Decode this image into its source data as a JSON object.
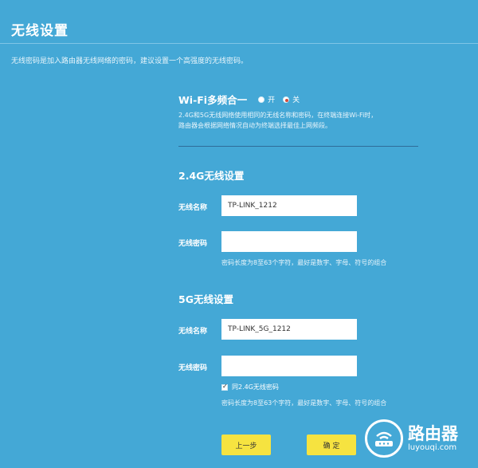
{
  "header": {
    "title": "无线设置",
    "intro": "无线密码是加入路由器无线网络的密码，建议设置一个高强度的无线密码。"
  },
  "wifi_multi": {
    "label": "Wi-Fi多频合一",
    "option_on": "开",
    "option_off": "关",
    "selected": "关",
    "description_line1": "2.4G和5G无线网络使用相同的无线名称和密码，在终端连接Wi-Fi时，",
    "description_line2": "路由器会根据网络情况自动为终端选择最佳上网频段。"
  },
  "band_24g": {
    "title": "2.4G无线设置",
    "ssid_label": "无线名称",
    "ssid_value": "TP-LINK_1212",
    "password_label": "无线密码",
    "password_value": "",
    "password_hint": "密码长度为8至63个字符，最好是数字、字母、符号的组合"
  },
  "band_5g": {
    "title": "5G无线设置",
    "ssid_label": "无线名称",
    "ssid_value": "TP-LINK_5G_1212",
    "password_label": "无线密码",
    "password_value": "",
    "same_password_label": "同2.4G无线密码",
    "same_password_checked": true,
    "password_hint": "密码长度为8至63个字符，最好是数字、字母、符号的组合"
  },
  "buttons": {
    "prev_label": "上一步",
    "confirm_label": "确 定"
  },
  "watermark": {
    "name": "路由器",
    "domain": "luyouqi.com"
  },
  "colors": {
    "background": "#44a8d6",
    "button": "#f6e340",
    "radio_selected": "#d24a3a"
  }
}
